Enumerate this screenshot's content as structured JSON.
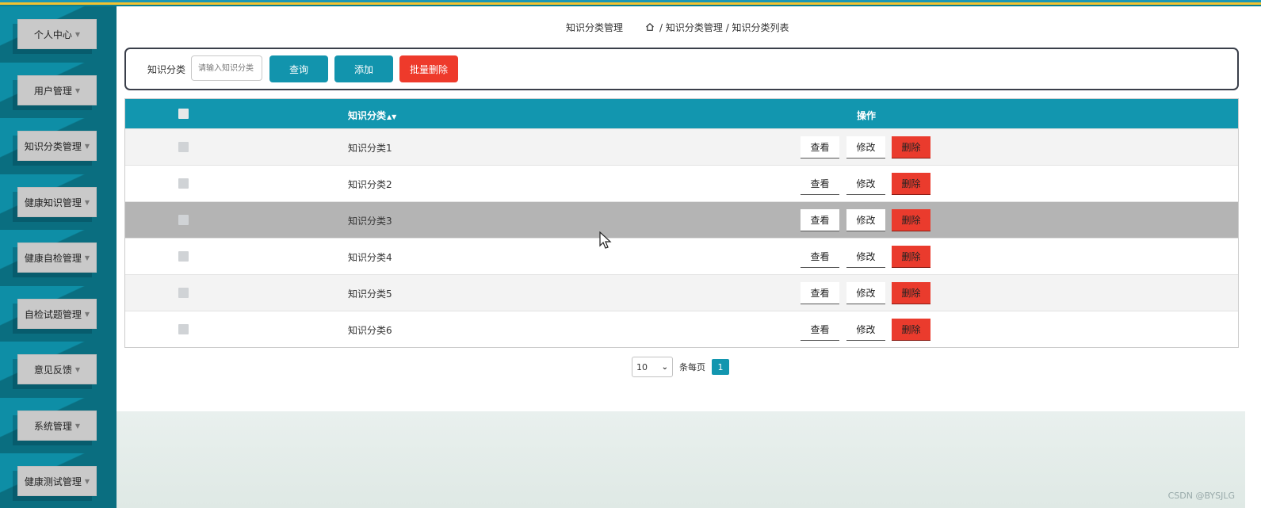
{
  "sidebar": {
    "items": [
      {
        "label": "个人中心"
      },
      {
        "label": "用户管理"
      },
      {
        "label": "知识分类管理"
      },
      {
        "label": "健康知识管理"
      },
      {
        "label": "健康自检管理"
      },
      {
        "label": "自检试题管理"
      },
      {
        "label": "意见反馈"
      },
      {
        "label": "系统管理"
      },
      {
        "label": "健康测试管理"
      }
    ]
  },
  "header": {
    "title": "知识分类管理",
    "breadcrumb": "/ 知识分类管理 / 知识分类列表"
  },
  "search": {
    "label": "知识分类",
    "placeholder": "请输入知识分类",
    "query_label": "查询",
    "add_label": "添加",
    "batch_delete_label": "批量删除"
  },
  "table": {
    "columns": {
      "name": "知识分类",
      "actions": "操作"
    },
    "rows": [
      {
        "name": "知识分类1"
      },
      {
        "name": "知识分类2"
      },
      {
        "name": "知识分类3"
      },
      {
        "name": "知识分类4"
      },
      {
        "name": "知识分类5"
      },
      {
        "name": "知识分类6"
      }
    ],
    "actions": {
      "view": "查看",
      "edit": "修改",
      "delete": "删除"
    }
  },
  "pagination": {
    "page_size": "10",
    "per_page_text": "条每页",
    "current_page": "1"
  },
  "watermark": "CSDN @BYSJLG",
  "colors": {
    "accent": "#1296af",
    "danger": "#ea3b2d",
    "sidebar": "#1aa3c0"
  }
}
